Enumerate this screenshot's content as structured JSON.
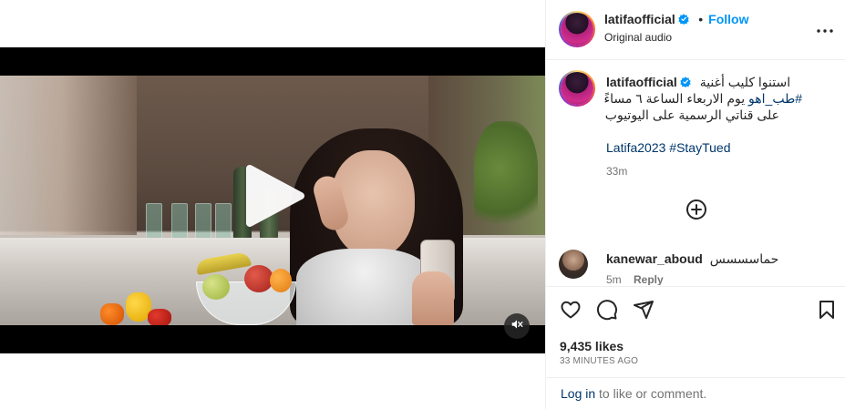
{
  "post": {
    "username": "latifaofficial",
    "follow_label": "Follow",
    "audio_label": "Original audio",
    "caption_line1": "استنوا كليب أغنية",
    "caption_hashtag1": "#طب_اهو",
    "caption_line2_rest": " يوم الاربعاء الساعة ٦ مساءً",
    "caption_line3": "على قناتي الرسمية على اليوتيوب",
    "caption_hashtag2": "#StayTued",
    "caption_hashtag3": "Latifa2023",
    "caption_time": "33m",
    "likes": "9,435 likes",
    "posted_ago": "33 MINUTES AGO"
  },
  "comments": [
    {
      "username": "kanewar_aboud",
      "text": "حماسسسس",
      "time": "5m",
      "reply_label": "Reply"
    }
  ],
  "footer": {
    "login_link": "Log in",
    "login_rest": " to like or comment."
  },
  "colors": {
    "accent_blue": "#0095f6",
    "link_dark_blue": "#00376b",
    "verified_blue": "#0095f6",
    "muted_text": "#737373"
  },
  "icons": {
    "play": "play-icon",
    "mute": "muted-speaker-icon",
    "verified": "verified-badge-icon",
    "more": "more-options-icon",
    "add": "add-circle-icon",
    "like": "heart-icon",
    "comment": "comment-icon",
    "share": "share-icon",
    "save": "bookmark-icon"
  }
}
